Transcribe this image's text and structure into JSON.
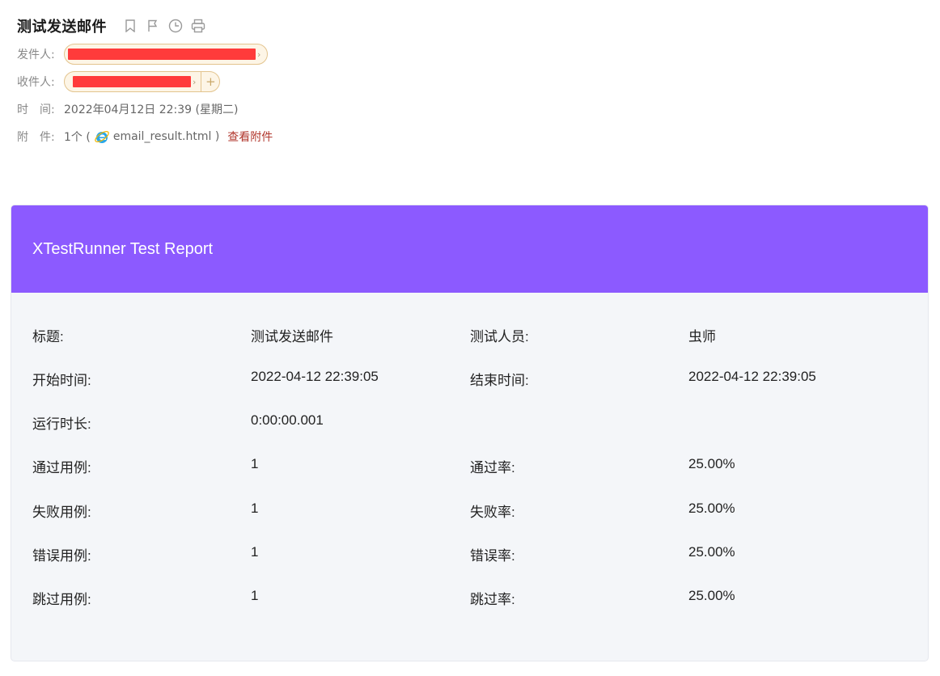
{
  "email": {
    "subject": "测试发送邮件",
    "icons": [
      "bookmark-icon",
      "flag-icon",
      "clock-icon",
      "print-icon"
    ],
    "sender_label": "发件人:",
    "recipient_label": "收件人:",
    "time_label": "时　间:",
    "time_value": "2022年04月12日 22:39 (星期二)",
    "attachment_label": "附　件:",
    "attachment_count": "1个 (",
    "attachment_name": "email_result.html )",
    "view_attachment": "查看附件"
  },
  "report": {
    "title": "XTestRunner Test Report",
    "header_color": "#8c5aff",
    "rows": [
      {
        "label1": "标题:",
        "value1": "测试发送邮件",
        "label2": "测试人员:",
        "value2": "虫师"
      },
      {
        "label1": "开始时间:",
        "value1": "2022-04-12 22:39:05",
        "label2": "结束时间:",
        "value2": "2022-04-12 22:39:05"
      },
      {
        "label1": "运行时长:",
        "value1": "0:00:00.001",
        "label2": "",
        "value2": ""
      },
      {
        "label1": "通过用例:",
        "value1": "1",
        "label2": "通过率:",
        "value2": "25.00%"
      },
      {
        "label1": "失败用例:",
        "value1": "1",
        "label2": "失败率:",
        "value2": "25.00%"
      },
      {
        "label1": "错误用例:",
        "value1": "1",
        "label2": "错误率:",
        "value2": "25.00%"
      },
      {
        "label1": "跳过用例:",
        "value1": "1",
        "label2": "跳过率:",
        "value2": "25.00%"
      }
    ]
  }
}
